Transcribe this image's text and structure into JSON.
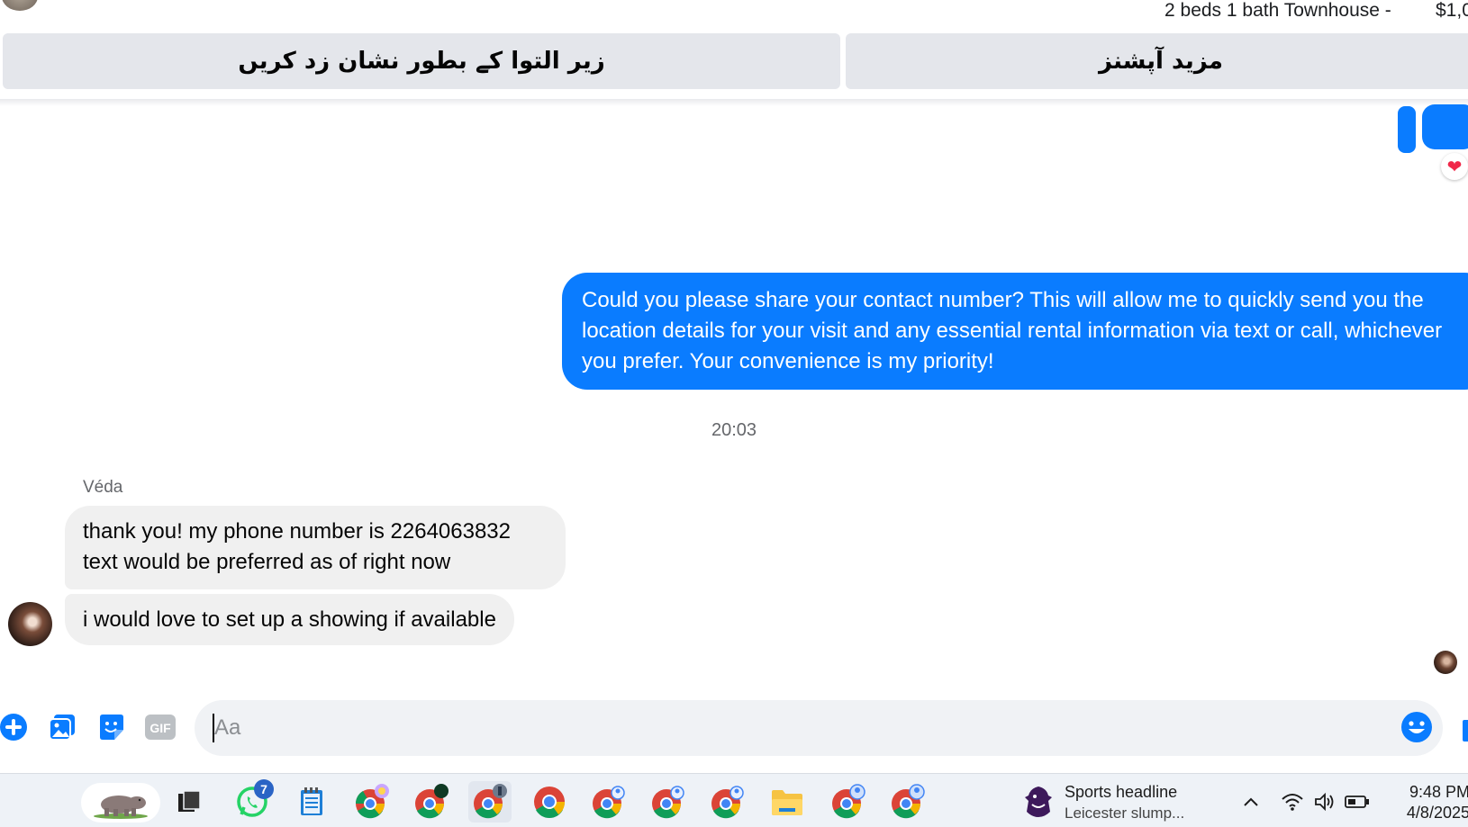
{
  "header": {
    "listing_title": "2 beds 1 bath Townhouse -",
    "listing_price": "$1,0",
    "mark_pending_label": "زیر التوا کے بطور نشان زد کریں",
    "more_options_label": "مزید آپشنز"
  },
  "messages": {
    "outgoing_text": "Could you please share your contact number? This will allow me to quickly send you the location details for your visit and any essential rental information via text or call, whichever you prefer. Your convenience is my priority!",
    "reaction": "❤",
    "timestamp": "20:03",
    "sender_name": "Véda",
    "incoming": [
      "thank you! my phone number is 2264063832 text would be preferred as of right now",
      "i would love to set up a showing if available"
    ]
  },
  "composer": {
    "placeholder": "Aa",
    "value": "",
    "gif_label": "GIF"
  },
  "taskbar": {
    "whatsapp_badge": "7",
    "news_title": "Sports headline",
    "news_subtitle": "Leicester slump...",
    "time": "9:48 PM",
    "date": "4/8/2025",
    "apps": [
      "hippo-widget",
      "task-view",
      "whatsapp",
      "notepad",
      "chrome-profile-1",
      "chrome-profile-2",
      "chrome-profile-3",
      "chrome",
      "chrome-profile-4",
      "chrome-profile-5",
      "chrome-profile-6",
      "file-explorer",
      "chrome-profile-7",
      "chrome-profile-8"
    ]
  },
  "colors": {
    "messenger_blue": "#0a7cff",
    "bubble_gray": "#f0f0f0",
    "button_gray": "#e4e6eb"
  }
}
